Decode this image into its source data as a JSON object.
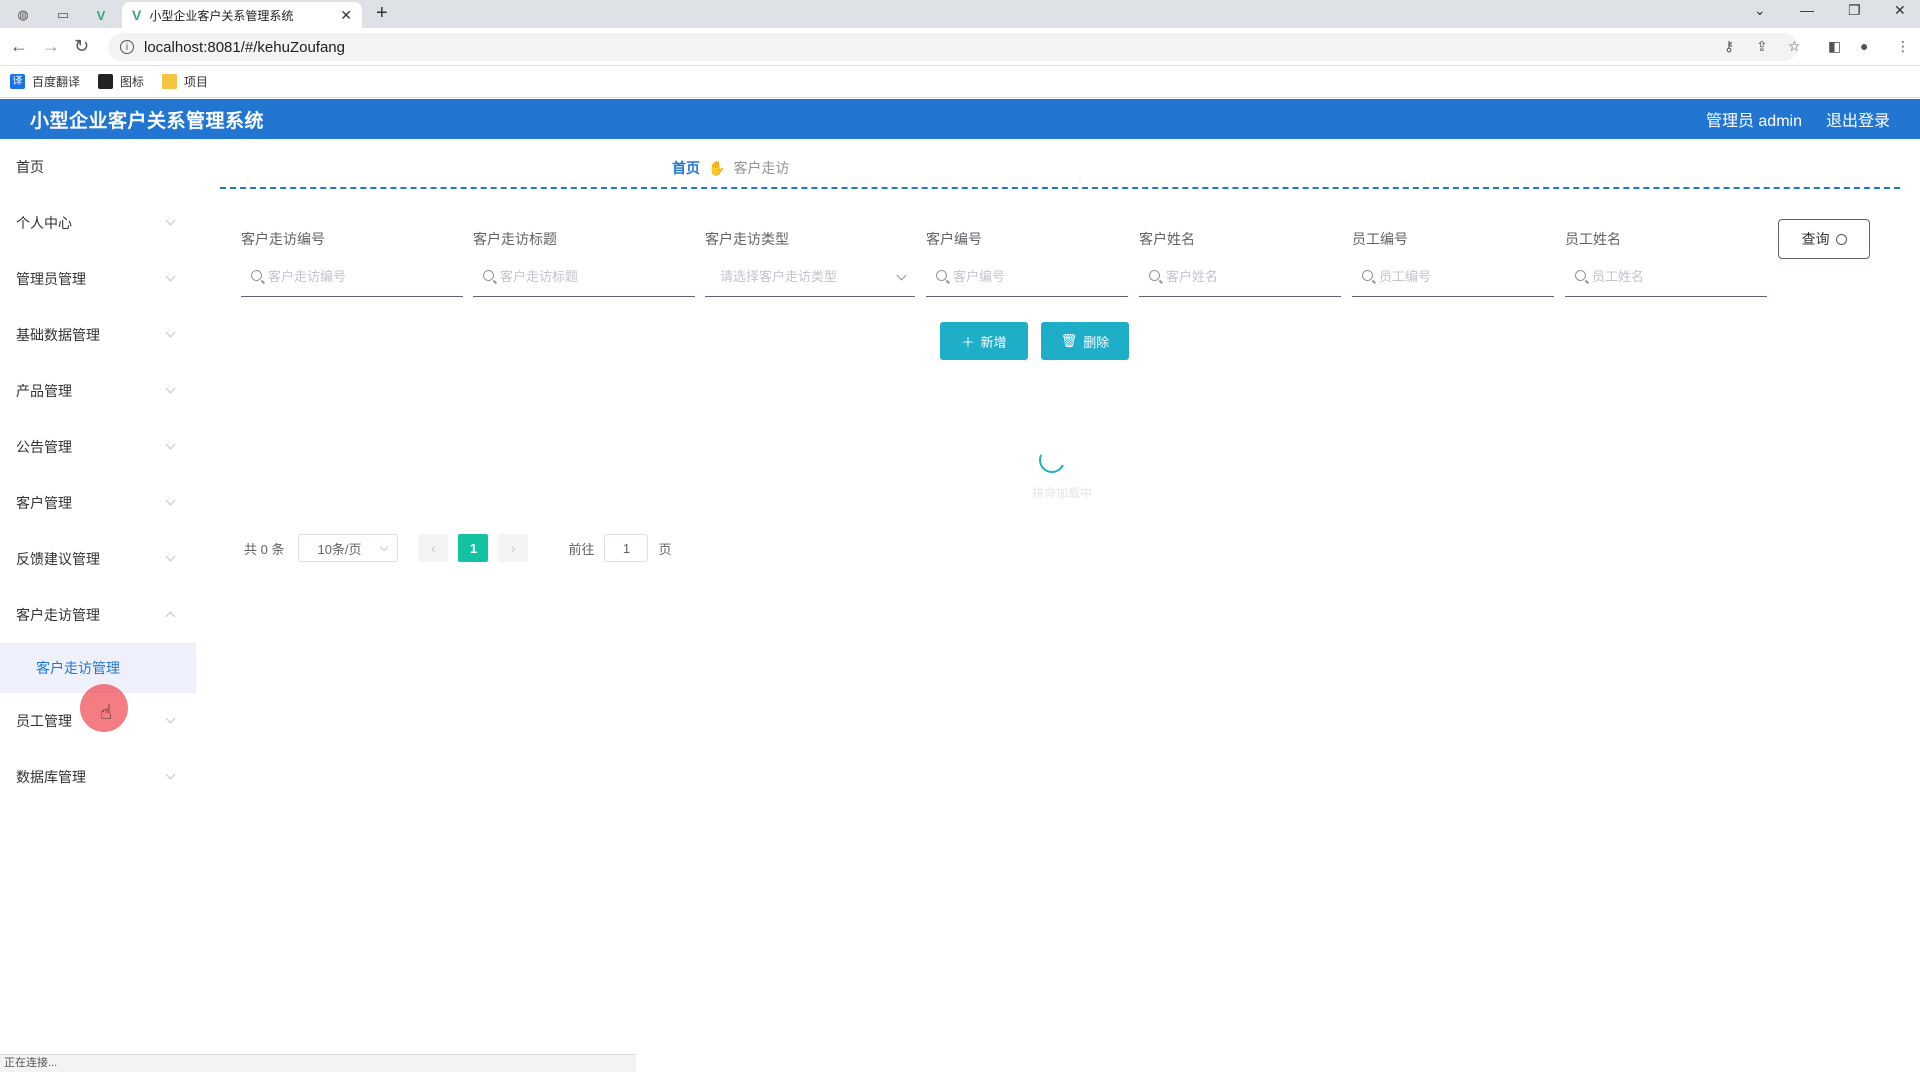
{
  "browser": {
    "tab_title": "小型企业客户关系管理系统",
    "new_tab_symbol": "+",
    "url": "localhost:8081/#/kehuZoufang",
    "bookmarks": [
      {
        "label": "百度翻译",
        "icon": "translate-icon"
      },
      {
        "label": "图标",
        "icon": "image-icon"
      },
      {
        "label": "项目",
        "icon": "folder-icon"
      }
    ],
    "status_text": "正在连接..."
  },
  "header": {
    "title": "小型企业客户关系管理系统",
    "user": "管理员 admin",
    "logout": "退出登录"
  },
  "sidebar": {
    "items": [
      {
        "label": "首页",
        "has_chevron": false
      },
      {
        "label": "个人中心",
        "has_chevron": true
      },
      {
        "label": "管理员管理",
        "has_chevron": true
      },
      {
        "label": "基础数据管理",
        "has_chevron": true
      },
      {
        "label": "产品管理",
        "has_chevron": true
      },
      {
        "label": "公告管理",
        "has_chevron": true
      },
      {
        "label": "客户管理",
        "has_chevron": true
      },
      {
        "label": "反馈建议管理",
        "has_chevron": true
      },
      {
        "label": "客户走访管理",
        "has_chevron": true,
        "expanded": true
      },
      {
        "label": "员工管理",
        "has_chevron": true
      },
      {
        "label": "数据库管理",
        "has_chevron": true
      }
    ],
    "submenu_active": "客户走访管理"
  },
  "breadcrumb": {
    "home": "首页",
    "current": "客户走访"
  },
  "search": {
    "fields": [
      {
        "label": "客户走访编号",
        "placeholder": "客户走访编号",
        "type": "text"
      },
      {
        "label": "客户走访标题",
        "placeholder": "客户走访标题",
        "type": "text"
      },
      {
        "label": "客户走访类型",
        "placeholder": "请选择客户走访类型",
        "type": "select"
      },
      {
        "label": "客户编号",
        "placeholder": "客户编号",
        "type": "text"
      },
      {
        "label": "客户姓名",
        "placeholder": "客户姓名",
        "type": "text"
      },
      {
        "label": "员工编号",
        "placeholder": "员工编号",
        "type": "text"
      },
      {
        "label": "员工姓名",
        "placeholder": "员工姓名",
        "type": "text"
      }
    ],
    "query_label": "查询"
  },
  "actions": {
    "add_label": "新增",
    "delete_label": "删除"
  },
  "table": {
    "loading": true,
    "loading_text": "拼命加载中"
  },
  "pagination": {
    "total_text": "共 0 条",
    "page_size": "10条/页",
    "current_page": "1",
    "goto_label": "前往",
    "goto_value": "1",
    "page_suffix": "页",
    "accent_color": "#13c2a0"
  },
  "colors": {
    "header_bg": "#2276d2",
    "button_bg": "#1eaec8"
  }
}
